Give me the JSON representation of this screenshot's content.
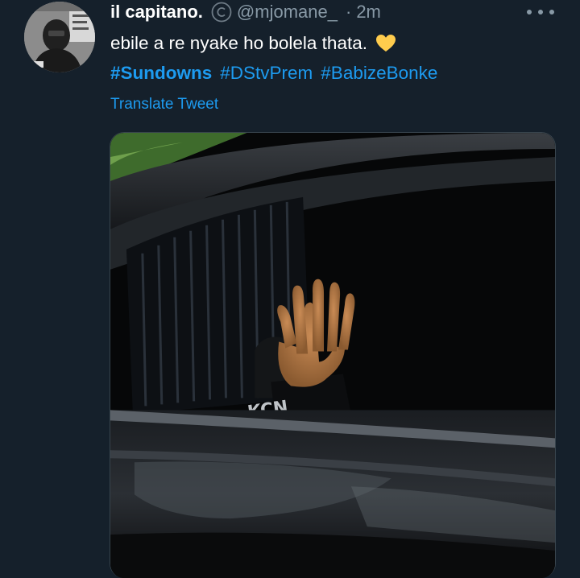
{
  "tweet": {
    "author": {
      "display_name": "il capitano.",
      "handle": "@mjomane_",
      "avatar_icon": "profile-photo"
    },
    "badge_icon": "copyright-circle-icon",
    "separator": "·",
    "timestamp": "2m",
    "more_icon": "more-horizontal-icon",
    "text": "ebile a re nyake ho bolela thata.",
    "emoji": "yellow-heart-icon",
    "hashtags": [
      "#Sundowns",
      "#DStvPrem",
      "#BabizeBonke"
    ],
    "translate_label": "Translate Tweet",
    "media": {
      "type": "photo",
      "visible_text": "KCN"
    }
  },
  "colors": {
    "background": "#15202b",
    "text_primary": "#ffffff",
    "text_secondary": "#8899a6",
    "link": "#1d9bf0",
    "heart": "#ffcc4d"
  }
}
